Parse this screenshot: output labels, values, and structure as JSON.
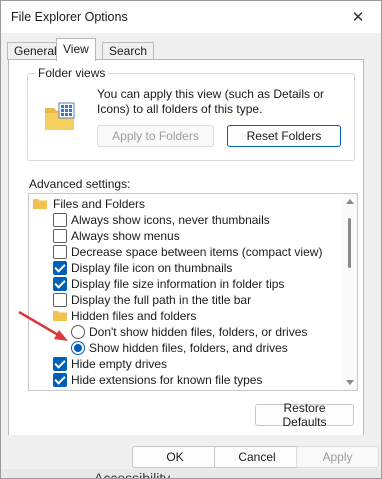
{
  "window": {
    "title": "File Explorer Options",
    "close_glyph": "✕"
  },
  "tabs": [
    {
      "label": "General",
      "active": false
    },
    {
      "label": "View",
      "active": true
    },
    {
      "label": "Search",
      "active": false
    }
  ],
  "folder_views": {
    "label": "Folder views",
    "description": "You can apply this view (such as Details or Icons) to all folders of this type.",
    "apply_button": "Apply to Folders",
    "reset_button": "Reset Folders",
    "icon": "folder-view-icon"
  },
  "advanced": {
    "label": "Advanced settings:",
    "items": [
      {
        "type": "folder",
        "label": "Files and Folders"
      },
      {
        "type": "checkbox",
        "label": "Always show icons, never thumbnails",
        "checked": false
      },
      {
        "type": "checkbox",
        "label": "Always show menus",
        "checked": false
      },
      {
        "type": "checkbox",
        "label": "Decrease space between items (compact view)",
        "checked": false
      },
      {
        "type": "checkbox",
        "label": "Display file icon on thumbnails",
        "checked": true
      },
      {
        "type": "checkbox",
        "label": "Display file size information in folder tips",
        "checked": true
      },
      {
        "type": "checkbox",
        "label": "Display the full path in the title bar",
        "checked": false
      },
      {
        "type": "folder",
        "label": "Hidden files and folders"
      },
      {
        "type": "radio",
        "label": "Don't show hidden files, folders, or drives",
        "checked": false
      },
      {
        "type": "radio",
        "label": "Show hidden files, folders, and drives",
        "checked": true
      },
      {
        "type": "checkbox",
        "label": "Hide empty drives",
        "checked": true
      },
      {
        "type": "checkbox",
        "label": "Hide extensions for known file types",
        "checked": true
      }
    ]
  },
  "restore_defaults": "Restore Defaults",
  "footer": {
    "ok": "OK",
    "cancel": "Cancel",
    "apply": "Apply"
  },
  "background_text": "Accessibility",
  "colors": {
    "accent": "#005fb8",
    "annotation_arrow": "#d93a3a"
  }
}
